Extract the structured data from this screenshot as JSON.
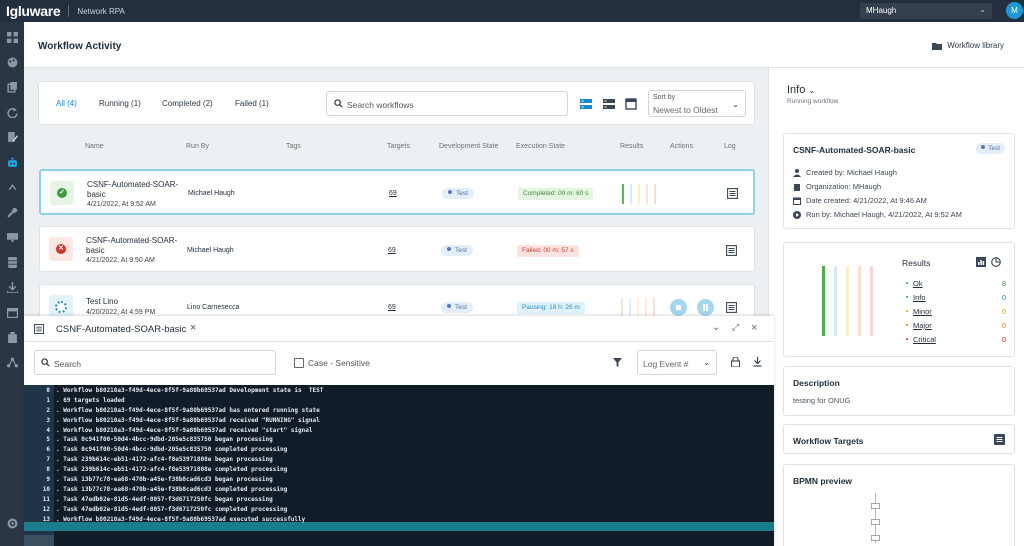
{
  "topbar": {
    "logo": "Igluware",
    "product": "Network RPA",
    "user": "MHaugh",
    "avatar_initial": "M"
  },
  "header": {
    "title": "Workflow Activity",
    "library_link": "Workflow library"
  },
  "filters": {
    "tabs": [
      "All (4)",
      "Running (1)",
      "Completed (2)",
      "Failed (1)"
    ],
    "active_tab": "All (4)",
    "search_placeholder": "Search workflows",
    "sort_label": "Sort by",
    "sort_value": "Newest to Oldest"
  },
  "columns": [
    "Name",
    "Run By",
    "Tags",
    "Targets",
    "Development State",
    "Execution State",
    "Results",
    "Actions",
    "Log"
  ],
  "rows": [
    {
      "name": "CSNF-Automated-SOAR-basic",
      "date": "4/21/2022, At 9:52 AM",
      "run_by": "Michael Haugh",
      "targets": "69",
      "dev_state": "Test",
      "exec_state": "Completed: 00 m: 60 s",
      "status": "completed"
    },
    {
      "name": "CSNF-Automated-SOAR-basic",
      "date": "4/21/2022, At 9:50 AM",
      "run_by": "Michael Haugh",
      "targets": "69",
      "dev_state": "Test",
      "exec_state": "Failed: 00 m: 57 s",
      "status": "failed"
    },
    {
      "name": "Test Lino",
      "date": "4/20/2022, At 4:59 PM",
      "run_by": "Lino Carnesecca",
      "targets": "69",
      "dev_state": "Test",
      "exec_state": "Pausing: 18 h: 26 m",
      "status": "running"
    }
  ],
  "log": {
    "title": "CSNF-Automated-SOAR-basic",
    "search_placeholder": "Search",
    "case_label": "Case - Sensitive",
    "event_select": "Log Event #",
    "lines": [
      {
        "n": "0",
        "t": ". Workflow b80210a3-f49d-4ece-8f5f-9a80b69537ad Development state is  TEST"
      },
      {
        "n": "1",
        "t": ". 69 targets loaded"
      },
      {
        "n": "2",
        "t": ". Workflow b80210a3-f49d-4ece-8f5f-9a80b69537ad has entered running state"
      },
      {
        "n": "3",
        "t": ". Workflow b80210a3-f49d-4ece-8f5f-9a80b69537ad received \"RUNNING\" signal"
      },
      {
        "n": "4",
        "t": ". Workflow b80210a3-f49d-4ece-8f5f-9a80b69537ad received \"start\" signal"
      },
      {
        "n": "5",
        "t": ". Task 0c941f00-50d4-4bcc-9dbd-205e5c835750 began processing"
      },
      {
        "n": "6",
        "t": ". Task 0c941f00-50d4-4bcc-9dbd-205e5c835750 completed processing"
      },
      {
        "n": "7",
        "t": ". Task 239b614c-eb51-4172-afc4-f8e53971808e began processing"
      },
      {
        "n": "8",
        "t": ". Task 239b614c-eb51-4172-afc4-f8e53971808e completed processing"
      },
      {
        "n": "9",
        "t": ". Task 13b77c78-ea68-470b-a45e-f38b8cad6cd3 began processing"
      },
      {
        "n": "10",
        "t": ". Task 13b77c78-ea68-470b-a45e-f38b8cad6cd3 completed processing"
      },
      {
        "n": "11",
        "t": ". Task 47edb02e-81d5-4edf-8057-f3d6717250fc began processing"
      },
      {
        "n": "12",
        "t": ". Task 47edb02e-81d5-4edf-8057-f3d6717250fc completed processing"
      },
      {
        "n": "13",
        "t": ". Workflow b80210a3-f49d-4ece-8f5f-9a80b69537ad executed successfully"
      }
    ]
  },
  "info": {
    "title": "Info",
    "subtitle": "Running workflow",
    "workflow_name": "CSNF-Automated-SOAR-basic",
    "badge": "Test",
    "created_by": "Created by: Michael Haugh",
    "organization": "Organization: MHaugh",
    "date_created": "Date created: 4/21/2022, At 9:46 AM",
    "run_by": "Run by: Michael Haugh, 4/21/2022, At 9:52 AM",
    "results_title": "Results",
    "results": [
      {
        "label": "Ok",
        "value": "8",
        "color": "#3e9c3a"
      },
      {
        "label": "Info",
        "value": "0",
        "color": "#2a8fc2"
      },
      {
        "label": "Minor",
        "value": "0",
        "color": "#e0a800"
      },
      {
        "label": "Major",
        "value": "0",
        "color": "#e07b00"
      },
      {
        "label": "Critical",
        "value": "0",
        "color": "#d6302a"
      }
    ],
    "description_title": "Description",
    "description": "testing for ONUG",
    "targets_title": "Workflow Targets",
    "bpmn_title": "BPMN preview"
  }
}
